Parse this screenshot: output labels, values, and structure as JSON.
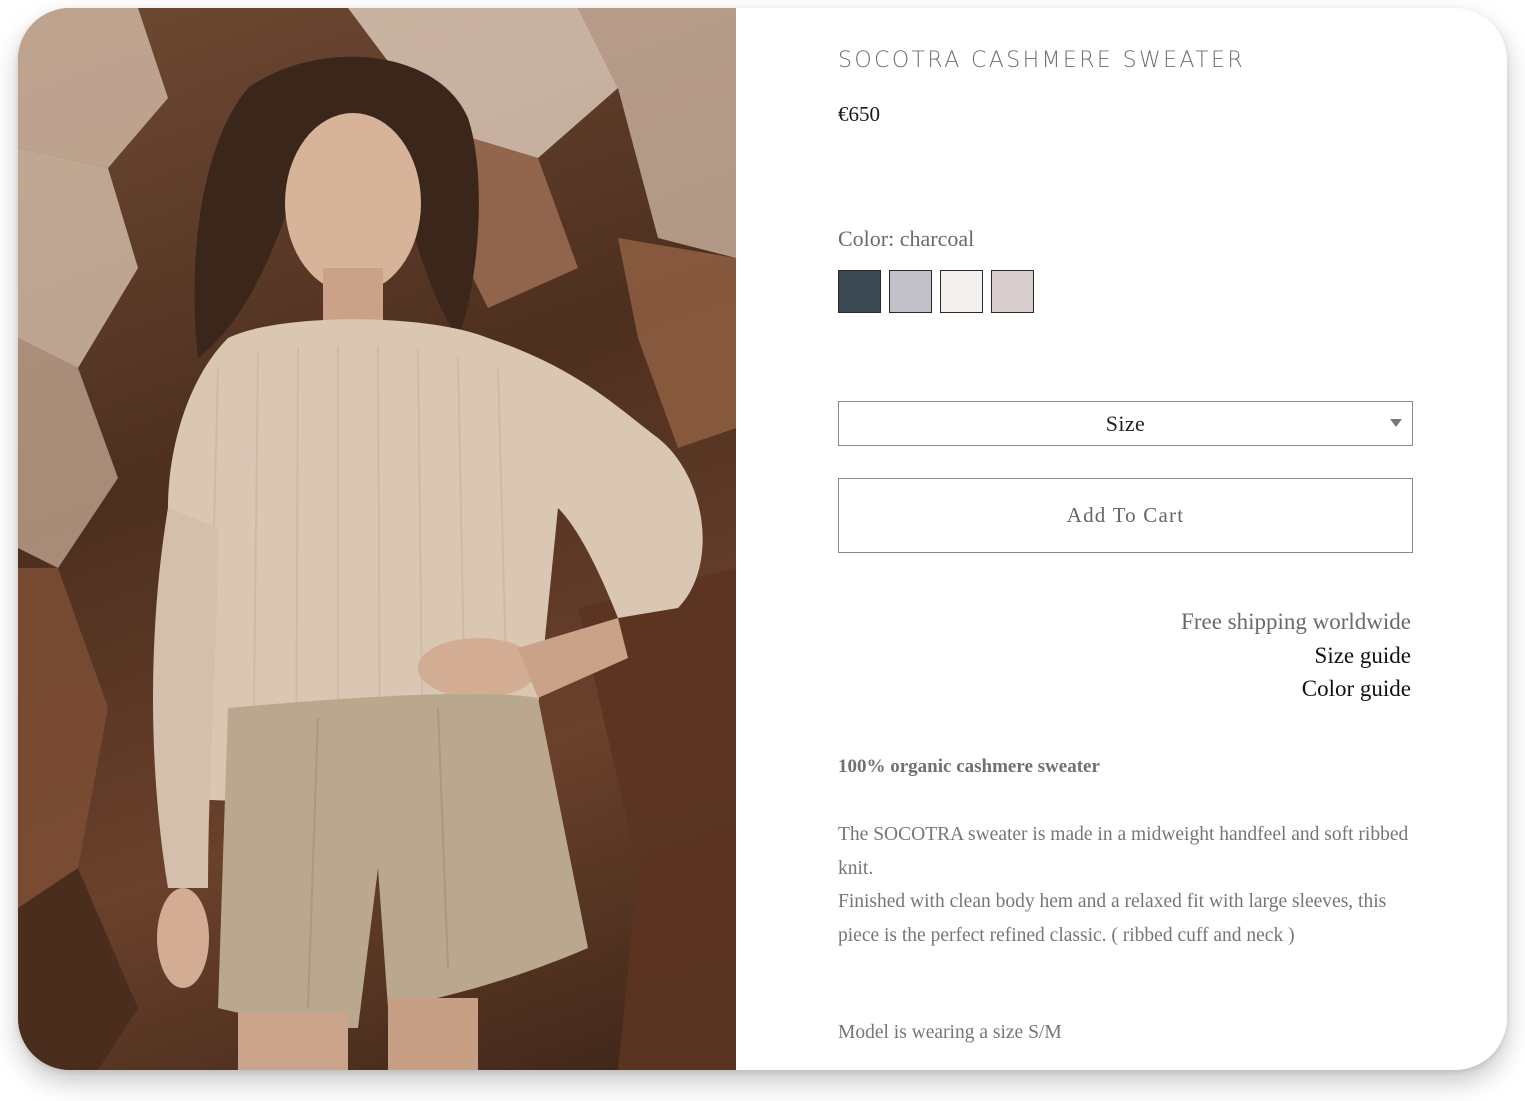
{
  "product": {
    "title": "SOCOTRA CASHMERE SWEATER",
    "price": "€650",
    "color_label": "Color:",
    "color_value": "charcoal",
    "swatches": [
      {
        "name": "charcoal",
        "hex": "#3a4852"
      },
      {
        "name": "light grey",
        "hex": "#c2c1c7"
      },
      {
        "name": "off white",
        "hex": "#f3efed"
      },
      {
        "name": "pale mauve",
        "hex": "#d8cecd"
      }
    ]
  },
  "size_select": {
    "label": "Size"
  },
  "add_to_cart": {
    "label": "Add To Cart"
  },
  "info_links": {
    "shipping": "Free shipping worldwide",
    "size_guide": "Size guide",
    "color_guide": "Color guide"
  },
  "description": {
    "heading": "100% organic cashmere sweater",
    "paragraph_1": "The SOCOTRA sweater is made in a midweight handfeel and soft ribbed knit.",
    "paragraph_2": "Finished with clean body hem and a relaxed fit with large sleeves, this piece is the perfect refined classic. ( ribbed cuff and neck )",
    "model_note": "Model is wearing a size S/M"
  },
  "colors": {
    "photo_rock": "#5a3826",
    "sweater": "#d8c5b3",
    "shorts": "#b9a88e"
  }
}
